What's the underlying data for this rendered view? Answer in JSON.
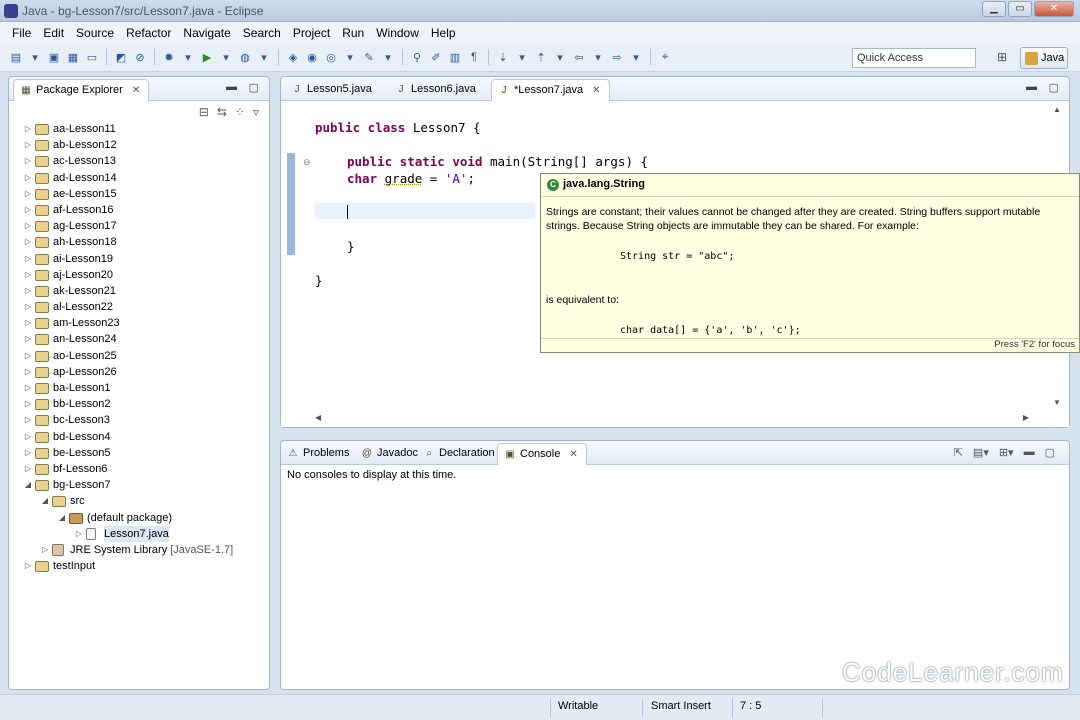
{
  "window": {
    "title": "Java - bg-Lesson7/src/Lesson7.java - Eclipse"
  },
  "menu": [
    "File",
    "Edit",
    "Source",
    "Refactor",
    "Navigate",
    "Search",
    "Project",
    "Run",
    "Window",
    "Help"
  ],
  "toolbar": {
    "quick_access": "Quick Access",
    "perspective": "Java"
  },
  "package_explorer": {
    "title": "Package Explorer",
    "items": [
      {
        "label": "aa-Lesson11",
        "level": 0,
        "type": "project",
        "expanded": false
      },
      {
        "label": "ab-Lesson12",
        "level": 0,
        "type": "project",
        "expanded": false
      },
      {
        "label": "ac-Lesson13",
        "level": 0,
        "type": "project",
        "expanded": false
      },
      {
        "label": "ad-Lesson14",
        "level": 0,
        "type": "project",
        "expanded": false
      },
      {
        "label": "ae-Lesson15",
        "level": 0,
        "type": "project",
        "expanded": false
      },
      {
        "label": "af-Lesson16",
        "level": 0,
        "type": "project",
        "expanded": false
      },
      {
        "label": "ag-Lesson17",
        "level": 0,
        "type": "project",
        "expanded": false
      },
      {
        "label": "ah-Lesson18",
        "level": 0,
        "type": "project",
        "expanded": false
      },
      {
        "label": "ai-Lesson19",
        "level": 0,
        "type": "project",
        "expanded": false
      },
      {
        "label": "aj-Lesson20",
        "level": 0,
        "type": "project",
        "expanded": false
      },
      {
        "label": "ak-Lesson21",
        "level": 0,
        "type": "project",
        "expanded": false
      },
      {
        "label": "al-Lesson22",
        "level": 0,
        "type": "project",
        "expanded": false
      },
      {
        "label": "am-Lesson23",
        "level": 0,
        "type": "project",
        "expanded": false
      },
      {
        "label": "an-Lesson24",
        "level": 0,
        "type": "project",
        "expanded": false
      },
      {
        "label": "ao-Lesson25",
        "level": 0,
        "type": "project",
        "expanded": false
      },
      {
        "label": "ap-Lesson26",
        "level": 0,
        "type": "project",
        "expanded": false
      },
      {
        "label": "ba-Lesson1",
        "level": 0,
        "type": "project",
        "expanded": false
      },
      {
        "label": "bb-Lesson2",
        "level": 0,
        "type": "project",
        "expanded": false
      },
      {
        "label": "bc-Lesson3",
        "level": 0,
        "type": "project",
        "expanded": false
      },
      {
        "label": "bd-Lesson4",
        "level": 0,
        "type": "project",
        "expanded": false
      },
      {
        "label": "be-Lesson5",
        "level": 0,
        "type": "project",
        "expanded": false
      },
      {
        "label": "bf-Lesson6",
        "level": 0,
        "type": "project",
        "expanded": false
      },
      {
        "label": "bg-Lesson7",
        "level": 0,
        "type": "project",
        "expanded": true
      },
      {
        "label": "src",
        "level": 1,
        "type": "srcfolder",
        "expanded": true
      },
      {
        "label": "(default package)",
        "level": 2,
        "type": "package",
        "expanded": true
      },
      {
        "label": "Lesson7.java",
        "level": 3,
        "type": "java",
        "expanded": false,
        "selected": true
      },
      {
        "label": "JRE System Library",
        "suffix": "[JavaSE-1.7]",
        "level": 1,
        "type": "library",
        "expanded": false
      },
      {
        "label": "testInput",
        "level": 0,
        "type": "project",
        "expanded": false
      }
    ]
  },
  "editor": {
    "tabs": [
      {
        "label": "Lesson5.java",
        "active": false
      },
      {
        "label": "Lesson6.java",
        "active": false
      },
      {
        "label": "*Lesson7.java",
        "active": true
      }
    ],
    "code": {
      "l1_kw": "public class",
      "l1_rest": " Lesson7 {",
      "l2_kw": "public static void",
      "l2_rest": " main(String[] args) {",
      "l3_kw": "char",
      "l3_var": "grade",
      "l3_mid": " = ",
      "l3_str": "'A'",
      "l3_end": ";",
      "l4": "}",
      "l5": "}"
    }
  },
  "tooltip": {
    "header": "java.lang.String",
    "p1": "Strings are constant; their values cannot be changed after they are created. String buffers support mutable strings. Because String objects are immutable they can be shared. For example:",
    "code1": "String str = \"abc\";",
    "p2": "is equivalent to:",
    "code2": "char data[] = {'a', 'b', 'c'};",
    "footer": "Press 'F2' for focus"
  },
  "console": {
    "tabs": [
      {
        "label": "Problems",
        "active": false
      },
      {
        "label": "Javadoc",
        "active": false
      },
      {
        "label": "Declaration",
        "active": false
      },
      {
        "label": "Console",
        "active": true
      }
    ],
    "message": "No consoles to display at this time."
  },
  "status": {
    "writable": "Writable",
    "insert": "Smart Insert",
    "position": "7 : 5"
  },
  "watermark": "CodeLearner.com"
}
